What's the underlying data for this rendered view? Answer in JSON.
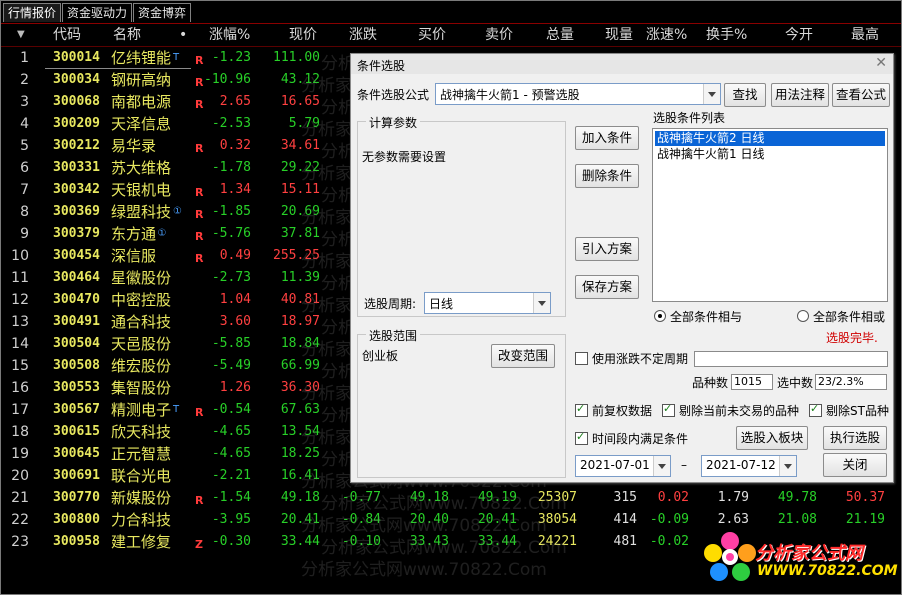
{
  "tabs": [
    "行情报价",
    "资金驱动力",
    "资金博弈"
  ],
  "header": {
    "dot": "▼",
    "code": "代码",
    "name": "名称",
    "bullet": "•",
    "pct": "涨幅%",
    "price": "现价",
    "chg": "涨跌",
    "bid": "买价",
    "ask": "卖价",
    "vol": "总量",
    "cur": "现量",
    "speed": "涨速%",
    "turn": "换手%",
    "open": "今开",
    "high": "最高"
  },
  "rows": [
    {
      "i": "1",
      "code": "300014",
      "name": "亿纬锂能",
      "sup": "T",
      "mark": "R",
      "pct": "-1.23",
      "pc": "dn",
      "price": "111.00",
      "prc": "dn"
    },
    {
      "i": "2",
      "code": "300034",
      "name": "钢研高纳",
      "sup": "",
      "mark": "R",
      "pct": "-10.96",
      "pc": "dn",
      "price": "43.12",
      "prc": "dn"
    },
    {
      "i": "3",
      "code": "300068",
      "name": "南都电源",
      "sup": "",
      "mark": "R",
      "pct": "2.65",
      "pc": "up",
      "price": "16.65",
      "prc": "up"
    },
    {
      "i": "4",
      "code": "300209",
      "name": "天泽信息",
      "sup": "",
      "mark": "",
      "pct": "-2.53",
      "pc": "dn",
      "price": "5.79",
      "prc": "dn"
    },
    {
      "i": "5",
      "code": "300212",
      "name": "易华录",
      "sup": "",
      "mark": "R",
      "pct": "0.32",
      "pc": "up",
      "price": "34.61",
      "prc": "up"
    },
    {
      "i": "6",
      "code": "300331",
      "name": "苏大维格",
      "sup": "",
      "mark": "",
      "pct": "-1.78",
      "pc": "dn",
      "price": "29.22",
      "prc": "dn"
    },
    {
      "i": "7",
      "code": "300342",
      "name": "天银机电",
      "sup": "",
      "mark": "R",
      "pct": "1.34",
      "pc": "up",
      "price": "15.11",
      "prc": "up"
    },
    {
      "i": "8",
      "code": "300369",
      "name": "绿盟科技",
      "sup": "①",
      "mark": "R",
      "pct": "-1.85",
      "pc": "dn",
      "price": "20.69",
      "prc": "dn"
    },
    {
      "i": "9",
      "code": "300379",
      "name": "东方通",
      "sup": "①",
      "mark": "R",
      "pct": "-5.76",
      "pc": "dn",
      "price": "37.81",
      "prc": "dn"
    },
    {
      "i": "10",
      "code": "300454",
      "name": "深信服",
      "sup": "",
      "mark": "R",
      "pct": "0.49",
      "pc": "up",
      "price": "255.25",
      "prc": "up"
    },
    {
      "i": "11",
      "code": "300464",
      "name": "星徽股份",
      "sup": "",
      "mark": "",
      "pct": "-2.73",
      "pc": "dn",
      "price": "11.39",
      "prc": "dn"
    },
    {
      "i": "12",
      "code": "300470",
      "name": "中密控股",
      "sup": "",
      "mark": "",
      "pct": "1.04",
      "pc": "up",
      "price": "40.81",
      "prc": "up"
    },
    {
      "i": "13",
      "code": "300491",
      "name": "通合科技",
      "sup": "",
      "mark": "",
      "pct": "3.60",
      "pc": "up",
      "price": "18.97",
      "prc": "up"
    },
    {
      "i": "14",
      "code": "300504",
      "name": "天邑股份",
      "sup": "",
      "mark": "",
      "pct": "-5.85",
      "pc": "dn",
      "price": "18.84",
      "prc": "dn"
    },
    {
      "i": "15",
      "code": "300508",
      "name": "维宏股份",
      "sup": "",
      "mark": "",
      "pct": "-5.49",
      "pc": "dn",
      "price": "66.99",
      "prc": "dn"
    },
    {
      "i": "16",
      "code": "300553",
      "name": "集智股份",
      "sup": "",
      "mark": "",
      "pct": "1.26",
      "pc": "up",
      "price": "36.30",
      "prc": "up"
    },
    {
      "i": "17",
      "code": "300567",
      "name": "精测电子",
      "sup": "T",
      "mark": "R",
      "pct": "-0.54",
      "pc": "dn",
      "price": "67.63",
      "prc": "dn"
    },
    {
      "i": "18",
      "code": "300615",
      "name": "欣天科技",
      "sup": "",
      "mark": "",
      "pct": "-4.65",
      "pc": "dn",
      "price": "13.54",
      "prc": "dn"
    },
    {
      "i": "19",
      "code": "300645",
      "name": "正元智慧",
      "sup": "",
      "mark": "",
      "pct": "-4.65",
      "pc": "dn",
      "price": "18.25",
      "prc": "dn"
    },
    {
      "i": "20",
      "code": "300691",
      "name": "联合光电",
      "sup": "",
      "mark": "",
      "pct": "-2.21",
      "pc": "dn",
      "price": "16.41",
      "prc": "dn"
    },
    {
      "i": "21",
      "code": "300770",
      "name": "新媒股份",
      "sup": "",
      "mark": "R",
      "pct": "-1.54",
      "pc": "dn",
      "price": "49.18",
      "prc": "dn",
      "chg": "-0.77",
      "bid": "49.18",
      "ask": "49.19",
      "vol": "25307",
      "cur": "315",
      "speed": "0.02",
      "sp": "up",
      "turn": "1.79",
      "open": "49.78",
      "oc": "dn",
      "high": "50.37",
      "hc": "up"
    },
    {
      "i": "22",
      "code": "300800",
      "name": "力合科技",
      "sup": "",
      "mark": "",
      "pct": "-3.95",
      "pc": "dn",
      "price": "20.41",
      "prc": "dn",
      "chg": "-0.84",
      "bid": "20.40",
      "ask": "20.41",
      "vol": "38054",
      "cur": "414",
      "speed": "-0.09",
      "sp": "dn",
      "turn": "2.63",
      "open": "21.08",
      "oc": "dn",
      "high": "21.19",
      "hc": "dn"
    },
    {
      "i": "23",
      "code": "300958",
      "name": "建工修复",
      "sup": "",
      "mark": "Z",
      "pct": "-0.30",
      "pc": "dn",
      "price": "33.44",
      "prc": "dn",
      "chg": "-0.10",
      "bid": "33.43",
      "ask": "33.44",
      "vol": "24221",
      "cur": "481",
      "speed": "-0.02",
      "sp": "dn",
      "turn": "",
      "open": "",
      "oc": "dn",
      "high": "",
      "hc": "dn"
    }
  ],
  "watermark": "分析家公式网www.70822.Com",
  "dialog": {
    "title": "条件选股",
    "formula_label": "条件选股公式",
    "formula_value": "战神擒牛火箭1 - 预警选股",
    "btn_find": "查找",
    "btn_usage": "用法注释",
    "btn_view": "查看公式",
    "params_title": "计算参数",
    "params_text": "无参数需要设置",
    "period_label": "选股周期:",
    "period_value": "日线",
    "btn_add": "加入条件",
    "btn_del": "删除条件",
    "btn_import": "引入方案",
    "btn_save": "保存方案",
    "list_title": "选股条件列表",
    "list_items": [
      "战神擒牛火箭2  日线",
      "战神擒牛火箭1  日线"
    ],
    "radio_and": "全部条件相与",
    "radio_or": "全部条件相或",
    "status": "选股完毕.",
    "range_title": "选股范围",
    "range_value": "创业板",
    "btn_range": "改变范围",
    "chk_period": "使用涨跌不定周期",
    "count_label": "品种数",
    "count_value": "1015",
    "selected_label": "选中数",
    "selected_value": "23/2.3%",
    "chk_restore": "前复权数据",
    "chk_exclude_untraded": "剔除当前未交易的品种",
    "chk_exclude_st": "剔除ST品种",
    "chk_interval": "时间段内满足条件",
    "btn_to_block": "选股入板块",
    "btn_execute": "执行选股",
    "date_from": "2021-07-01",
    "date_sep": "–",
    "date_to": "2021-07-12",
    "btn_close": "关闭"
  },
  "logo": {
    "line1": "分析家公式网",
    "line2": "WWW.70822.COM"
  }
}
